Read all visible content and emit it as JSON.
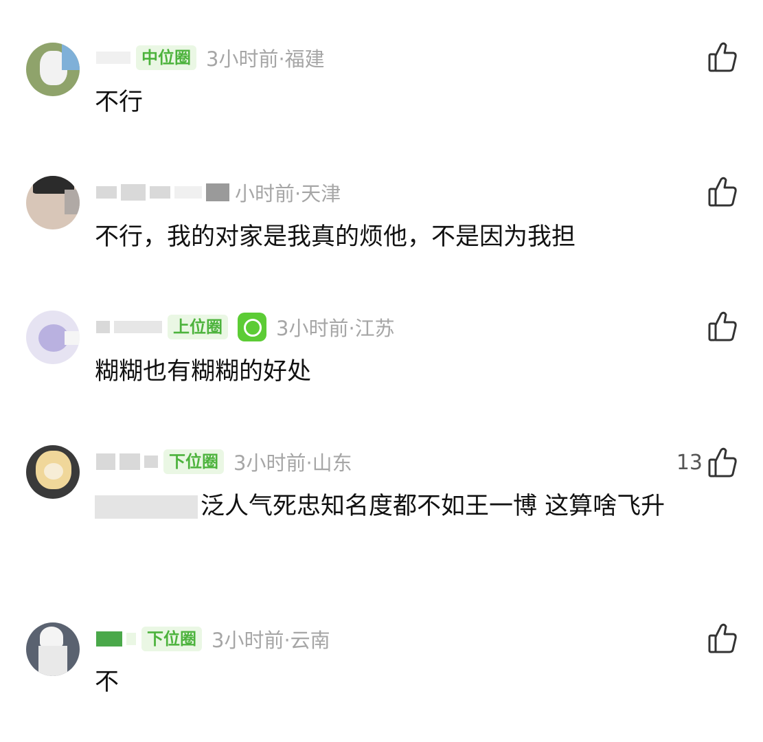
{
  "comments": [
    {
      "badge": "中位圈",
      "time": "3小时前",
      "location": "福建",
      "text": "不行",
      "likes": "",
      "has_level_icon": false
    },
    {
      "badge": "",
      "time": "小时前",
      "location": "天津",
      "text": "不行，我的对家是我真的烦他，不是因为我担",
      "likes": "",
      "has_level_icon": false
    },
    {
      "badge": "上位圈",
      "time": "3小时前",
      "location": "江苏",
      "text": "糊糊也有糊糊的好处",
      "likes": "",
      "has_level_icon": true
    },
    {
      "badge": "下位圈",
      "time": "3小时前",
      "location": "山东",
      "text": "泛人气死忠知名度都不如王一博  这算啥飞升",
      "likes": "13",
      "has_level_icon": false
    },
    {
      "badge": "下位圈",
      "time": "3小时前",
      "location": "云南",
      "text": "不",
      "likes": "",
      "has_level_icon": false
    }
  ],
  "separator": "·",
  "icons": {
    "like": "thumbs-up-icon",
    "level": "level-badge-icon"
  },
  "colors": {
    "badge_bg": "#eaf7e4",
    "badge_text": "#4db33d",
    "meta_text": "#a6a6a6",
    "body_text": "#111111"
  }
}
